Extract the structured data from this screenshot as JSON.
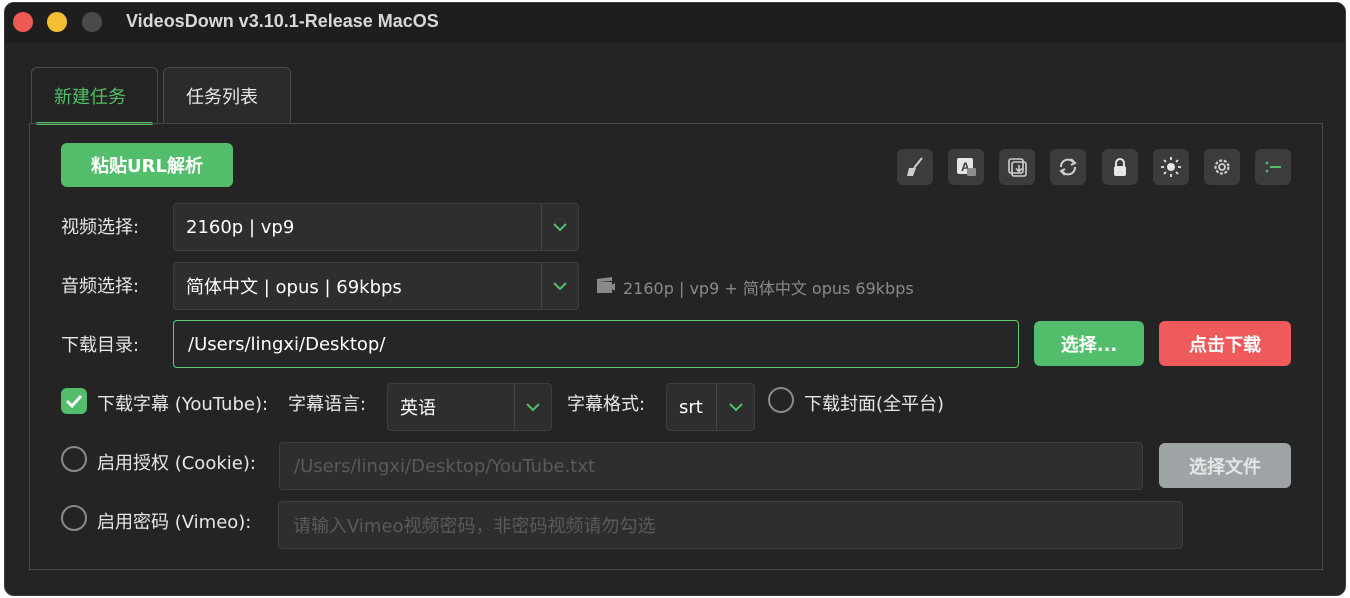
{
  "window": {
    "title": "VideosDown v3.10.1-Release  MacOS"
  },
  "tabs": [
    {
      "label": "新建任务",
      "active": true
    },
    {
      "label": "任务列表",
      "active": false
    }
  ],
  "toolbar": {
    "paste_button": "粘贴URL解析",
    "icons": [
      "broom-icon",
      "translate-icon",
      "import-icon",
      "refresh-icon",
      "lock-icon",
      "brightness-icon",
      "gear-icon",
      "list-icon"
    ]
  },
  "video": {
    "label": "视频选择:",
    "value": "2160p | vp9"
  },
  "audio": {
    "label": "音频选择:",
    "value": "简体中文 | opus | 69kbps",
    "summary": "2160p | vp9 + 简体中文 opus 69kbps"
  },
  "download": {
    "label": "下载目录:",
    "path": "/Users/lingxi/Desktop/",
    "choose_button": "选择...",
    "download_button": "点击下载"
  },
  "subtitle": {
    "checkbox_label": "下载字幕 (YouTube):",
    "checked": true,
    "lang_label": "字幕语言:",
    "lang_value": "英语",
    "format_label": "字幕格式:",
    "format_value": "srt",
    "cover_label": "下载封面(全平台)",
    "cover_checked": false
  },
  "cookie": {
    "checkbox_label": "启用授权 (Cookie):",
    "checked": false,
    "placeholder": "/Users/lingxi/Desktop/YouTube.txt",
    "file_button": "选择文件"
  },
  "vimeo": {
    "checkbox_label": "启用密码 (Vimeo):",
    "checked": false,
    "placeholder": "请输入Vimeo视频密码，非密码视频请勿勾选"
  },
  "colors": {
    "accent_green": "#52bd6a",
    "danger_red": "#ef5b5d",
    "background": "#242424"
  }
}
